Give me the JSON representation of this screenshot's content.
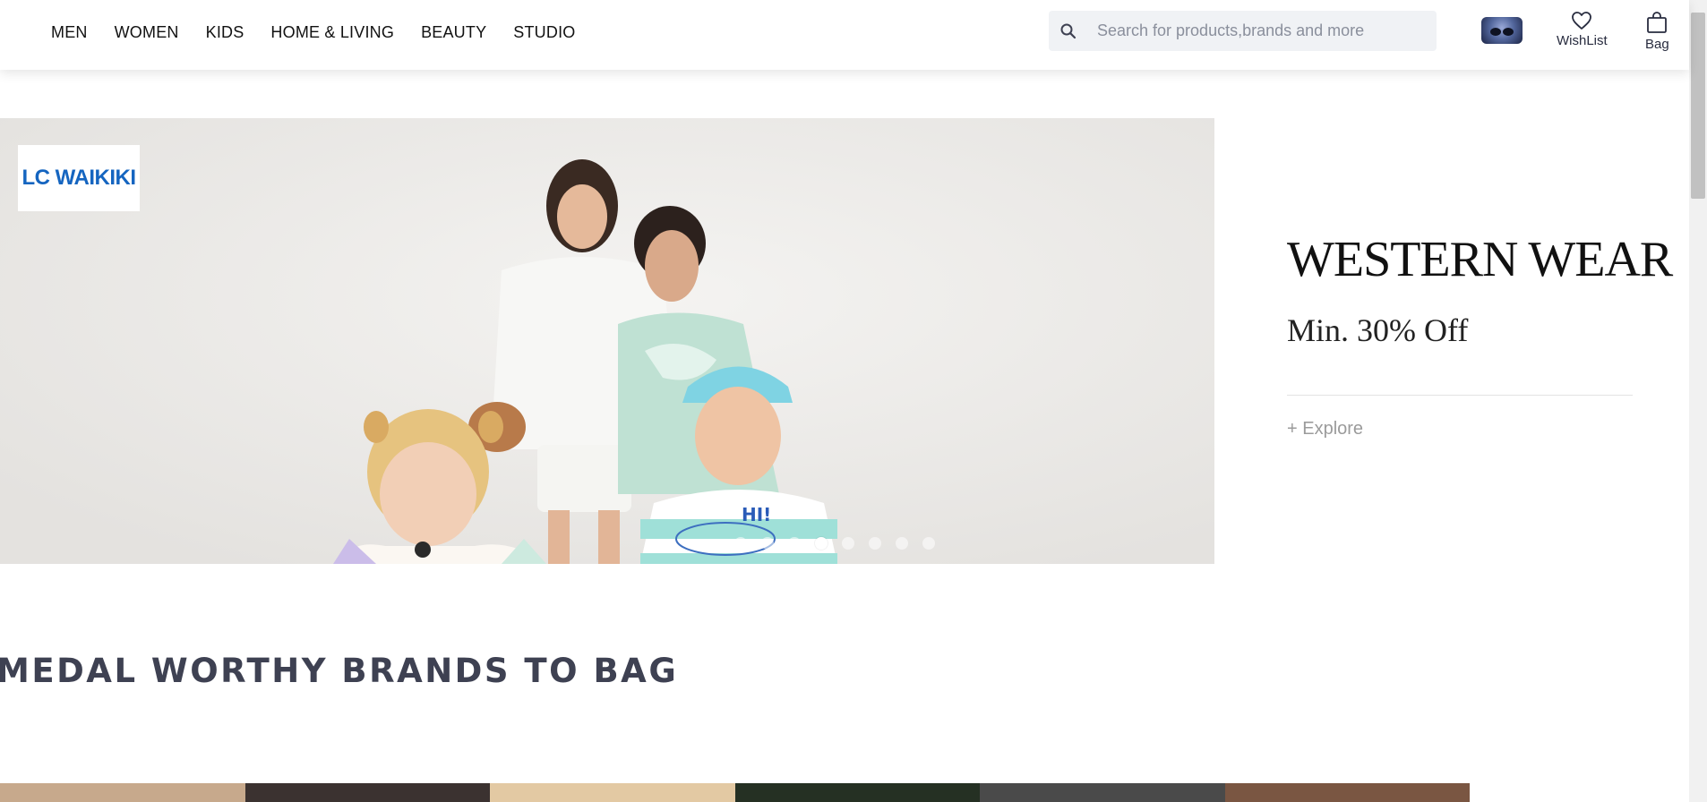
{
  "header": {
    "nav": [
      "MEN",
      "WOMEN",
      "KIDS",
      "HOME & LIVING",
      "BEAUTY",
      "STUDIO"
    ],
    "search_placeholder": "Search for products,brands and more",
    "wishlist_label": "WishList",
    "bag_label": "Bag"
  },
  "banner": {
    "brand_logo": "LC WAIKIKI",
    "carousel": {
      "slide_count": 8,
      "active_index": 3
    }
  },
  "promo": {
    "title": "WESTERN WEAR",
    "subtitle": "Min. 30% Off",
    "cta": "+ Explore"
  },
  "section": {
    "title": "MEDAL WORTHY BRANDS TO BAG"
  },
  "colors": {
    "brand_blue": "#1565c0",
    "heading": "#3e4152",
    "tile_colors": [
      "#c7a98c",
      "#3b3230",
      "#e3c9a3",
      "#253023",
      "#4a4a4a",
      "#7a5642"
    ]
  }
}
